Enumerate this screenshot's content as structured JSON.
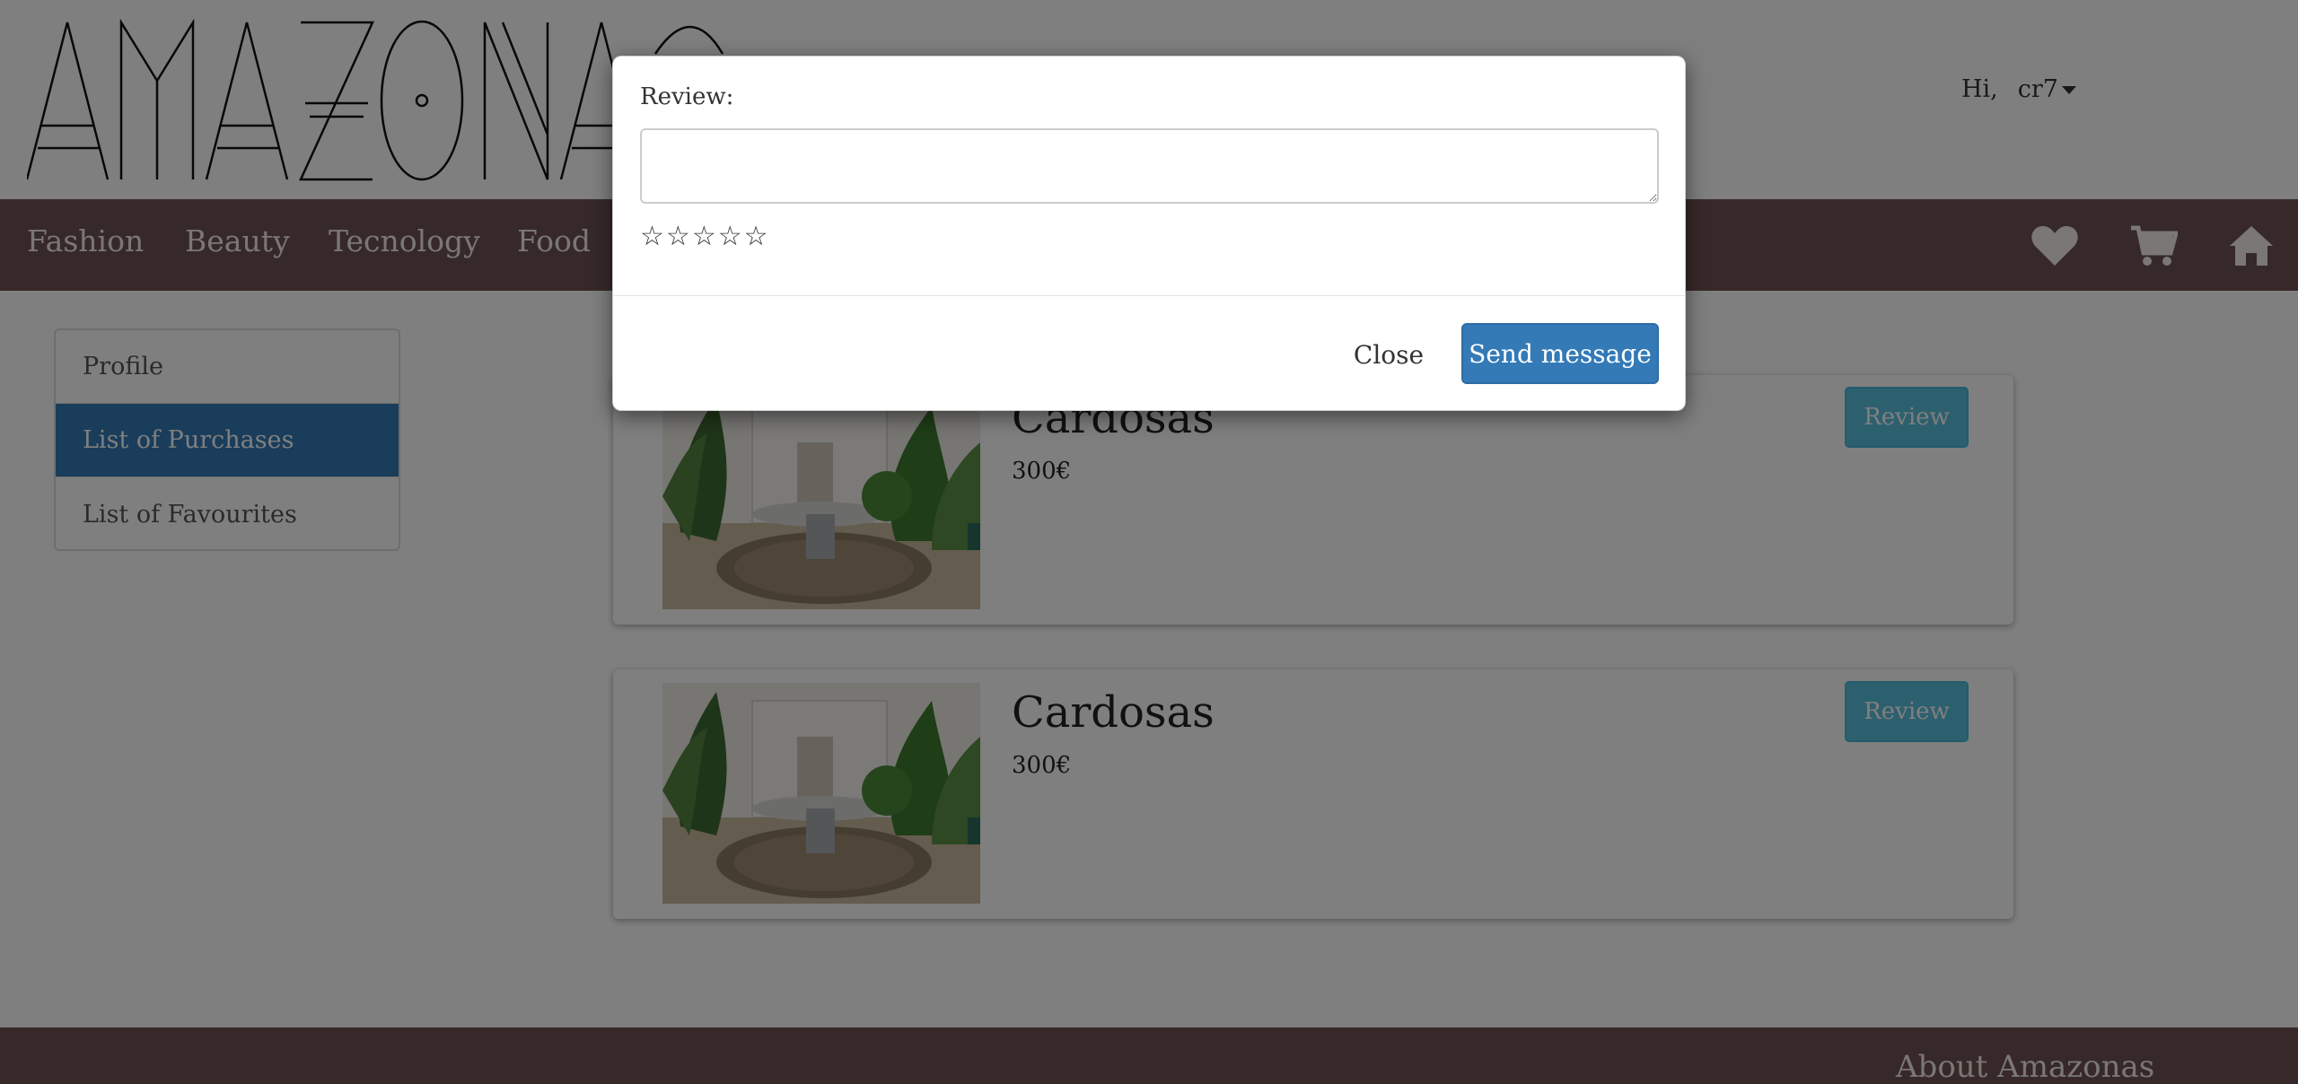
{
  "header": {
    "logo_text": "AMAZONAS",
    "greeting": "Hi,",
    "username": "cr7"
  },
  "nav": {
    "items": [
      {
        "label": "Fashion"
      },
      {
        "label": "Beauty"
      },
      {
        "label": "Tecnology"
      },
      {
        "label": "Food"
      }
    ],
    "icons": [
      "heart-icon",
      "cart-icon",
      "home-icon"
    ]
  },
  "sidebar": {
    "items": [
      {
        "label": "Profile",
        "active": false
      },
      {
        "label": "List of Purchases",
        "active": true
      },
      {
        "label": "List of Favourites",
        "active": false
      }
    ]
  },
  "purchases": [
    {
      "title": "Cardosas",
      "price": "300€",
      "action": "Review"
    },
    {
      "title": "Cardosas",
      "price": "300€",
      "action": "Review"
    }
  ],
  "footer": {
    "title": "About Amazonas"
  },
  "modal": {
    "label": "Review:",
    "textarea_value": "",
    "star_glyph": "☆",
    "star_count": 5,
    "rating": 0,
    "close_label": "Close",
    "send_label": "Send message"
  },
  "colors": {
    "nav_bg": "#6e5353",
    "primary": "#337ab7",
    "info": "#5bc0de"
  }
}
